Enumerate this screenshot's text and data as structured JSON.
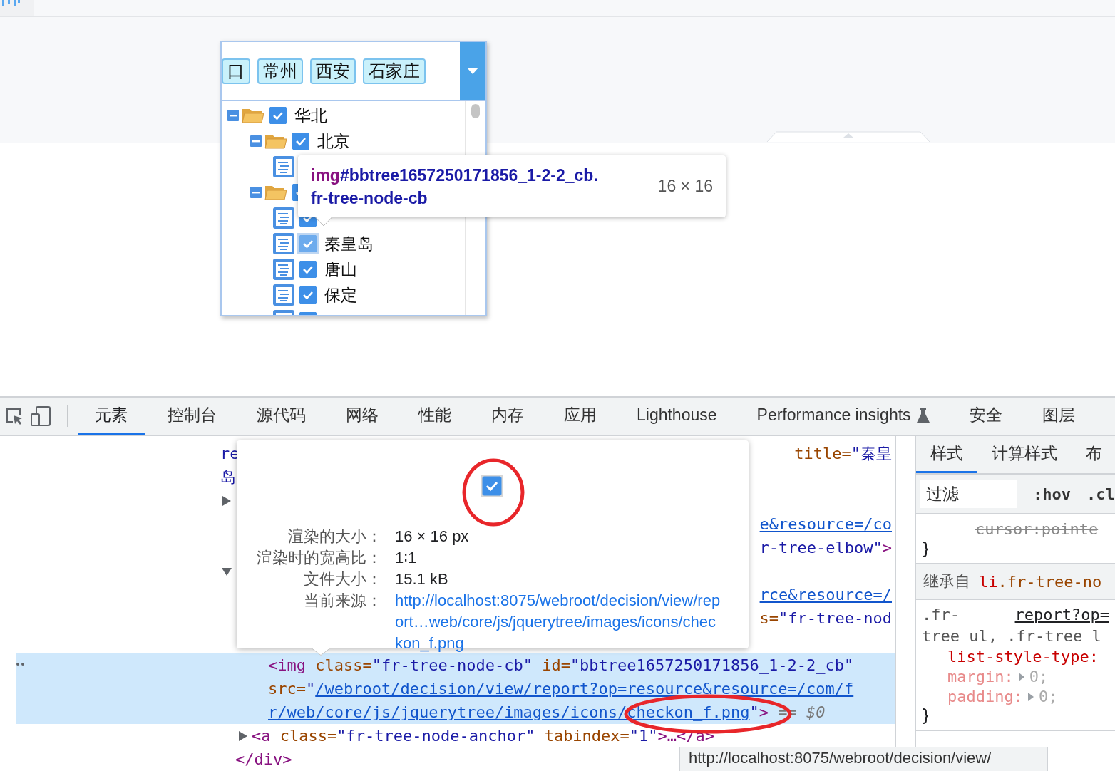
{
  "tree_select": {
    "tags": [
      "口",
      "常州",
      "西安",
      "石家庄"
    ],
    "tree": [
      {
        "label": "华北",
        "kind": "folder",
        "expanded": true,
        "checked": true,
        "selected": false,
        "children": [
          {
            "label": "北京",
            "kind": "folder",
            "expanded": true,
            "checked": true,
            "selected": false,
            "children": [
              {
                "kind": "leaf"
              }
            ]
          },
          {
            "kind": "folder",
            "expanded": true,
            "checked": true,
            "selected": false,
            "children": [
              {
                "kind": "leaf",
                "checked": true,
                "selected": false
              },
              {
                "label": "秦皇岛",
                "kind": "leaf",
                "checked": true,
                "selected": true
              },
              {
                "label": "唐山",
                "kind": "leaf",
                "checked": true,
                "selected": false
              },
              {
                "label": "保定",
                "kind": "leaf",
                "checked": true,
                "selected": false
              },
              {
                "kind": "leaf",
                "checked": true,
                "selected": false
              }
            ]
          }
        ]
      }
    ]
  },
  "element_tooltip": {
    "tag": "img",
    "selector": "#bbtree1657250171856_1-2-2_cb.",
    "class": "fr-tree-node-cb",
    "size": "16 × 16"
  },
  "devtools": {
    "tabs": [
      {
        "label": "元素",
        "selected": true
      },
      {
        "label": "控制台",
        "selected": false
      },
      {
        "label": "源代码",
        "selected": false
      },
      {
        "label": "网络",
        "selected": false
      },
      {
        "label": "性能",
        "selected": false
      },
      {
        "label": "内存",
        "selected": false
      },
      {
        "label": "应用",
        "selected": false
      },
      {
        "label": "Lighthouse",
        "selected": false
      },
      {
        "label": "Performance insights",
        "selected": false,
        "experimental": true
      },
      {
        "label": "安全",
        "selected": false
      },
      {
        "label": "图层",
        "selected": false
      }
    ],
    "nodes": [
      {
        "selected": false,
        "lines": [
          {
            "left": [
              {
                "t": "re",
                "kind": "value"
              }
            ],
            "right": [
              {
                "t": "title=",
                "kind": "attr"
              },
              {
                "t": "\"秦皇",
                "kind": "value"
              }
            ]
          },
          {
            "left": [
              {
                "t": "岛",
                "kind": "value"
              }
            ]
          }
        ]
      },
      {
        "expanded": false,
        "selected": false,
        "lines": [
          {
            "right": [
              {
                "t": "e&resource=/co",
                "kind": "link"
              }
            ]
          },
          {
            "right": [
              {
                "t": "r-tree-elbow\"",
                "kind": "value"
              },
              {
                "t": ">",
                "kind": "tag"
              }
            ]
          }
        ]
      },
      {
        "expanded": true,
        "selected": false,
        "lines": [
          {
            "right": [
              {
                "t": "rce&resource=/",
                "kind": "link"
              }
            ]
          },
          {
            "right": [
              {
                "t": "s=",
                "kind": "attr"
              },
              {
                "t": "\"fr-tree-nod",
                "kind": "value"
              }
            ]
          }
        ],
        "children": [
          {
            "selected": true,
            "lines": [
              {
                "left": [
                  {
                    "t": "<img ",
                    "kind": "tag"
                  },
                  {
                    "t": "class=",
                    "kind": "attr"
                  },
                  {
                    "t": "\"fr-tree-node-cb\"",
                    "kind": "value"
                  },
                  {
                    "t": " id=",
                    "kind": "attr"
                  },
                  {
                    "t": "\"bbtree1657250171856_1-2-2_cb\"",
                    "kind": "value"
                  }
                ]
              },
              {
                "left": [
                  {
                    "t": "src=",
                    "kind": "attr"
                  },
                  {
                    "t": "\"",
                    "kind": "value"
                  },
                  {
                    "t": "/webroot/decision/view/report?op=resource&resource=/com/f",
                    "kind": "link"
                  }
                ]
              },
              {
                "left": [
                  {
                    "t": "r/web/core/js/jquerytree/images/icons/checkon_f.png",
                    "kind": "link"
                  },
                  {
                    "t": "\"",
                    "kind": "value"
                  },
                  {
                    "t": ">",
                    "kind": "tag"
                  },
                  {
                    "t": " == $0",
                    "kind": "muted"
                  }
                ]
              }
            ]
          },
          {
            "expanded": false,
            "selected": false,
            "lines": [
              {
                "left": [
                  {
                    "t": "<a ",
                    "kind": "tag"
                  },
                  {
                    "t": "class=",
                    "kind": "attr"
                  },
                  {
                    "t": "\"fr-tree-node-anchor\"",
                    "kind": "value"
                  },
                  {
                    "t": " tabindex=",
                    "kind": "attr"
                  },
                  {
                    "t": "\"1\"",
                    "kind": "value"
                  },
                  {
                    "t": ">…</a>",
                    "kind": "tag"
                  }
                ]
              }
            ]
          }
        ],
        "close": "</div>"
      }
    ],
    "image_popover": {
      "preview_checked": true,
      "rows": [
        {
          "label": "渲染的大小：",
          "value": "16 × 16 px"
        },
        {
          "label": "渲染时的宽高比：",
          "value": "1∶1"
        },
        {
          "label": "文件大小：",
          "value": "15.1 kB"
        },
        {
          "label": "当前来源：",
          "value": "http://localhost:8075/webroot/decision/view/report…web/core/js/jquerytree/images/icons/checkon_f.png",
          "kind": "link"
        }
      ]
    },
    "styles": {
      "tabs": [
        {
          "label": "样式",
          "selected": true
        },
        {
          "label": "计算样式",
          "selected": false
        },
        {
          "label": "布",
          "selected": false
        }
      ],
      "filter": {
        "placeholder": "过滤"
      },
      "buttons": [
        ":hov",
        ".cl"
      ],
      "overridden": "cursor:pointe",
      "inherited": {
        "label": "继承自",
        "tag": "li",
        "class": ".fr-tree-no"
      },
      "rule": {
        "selector": [
          ".fr-",
          "tree ul, .fr-tree l"
        ],
        "source": "report?op=",
        "decls": [
          {
            "prop": "list-style-type:",
            "active": true
          },
          {
            "prop": "margin:",
            "value": "0;",
            "active": false
          },
          {
            "prop": "padding:",
            "value": "0;",
            "active": false
          }
        ]
      }
    },
    "status_url": "http://localhost:8075/webroot/decision/view/"
  }
}
